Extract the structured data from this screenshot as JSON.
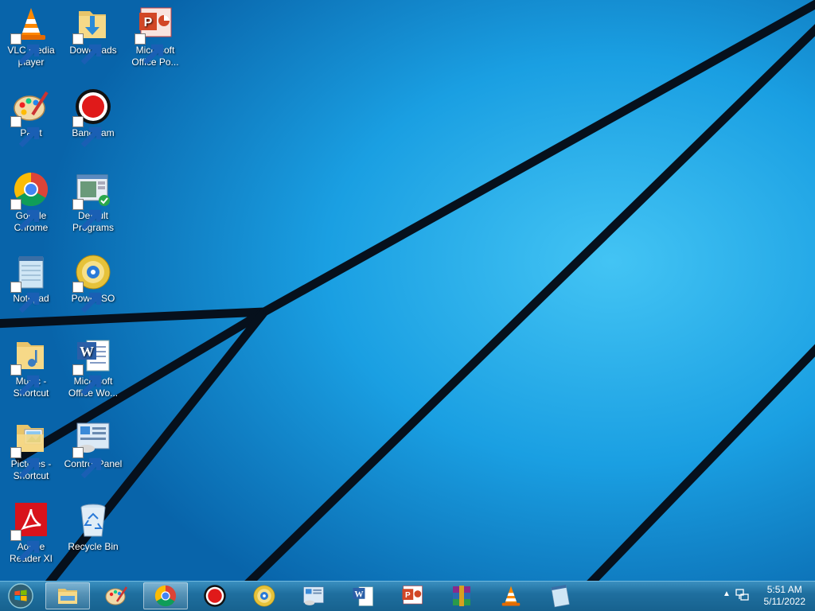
{
  "desktop": {
    "icons": [
      {
        "label": "VLC media player",
        "icon": "vlc-icon"
      },
      {
        "label": "Downloads",
        "icon": "downloads-folder-icon"
      },
      {
        "label": "Microsoft Office Po...",
        "icon": "powerpoint-icon"
      },
      {
        "label": "Paint",
        "icon": "paint-icon"
      },
      {
        "label": "Bandicam",
        "icon": "bandicam-icon"
      },
      {
        "label": "Google Chrome",
        "icon": "chrome-icon"
      },
      {
        "label": "Default Programs",
        "icon": "default-programs-icon"
      },
      {
        "label": "Notepad",
        "icon": "notepad-icon"
      },
      {
        "label": "PowerISO",
        "icon": "poweriso-icon"
      },
      {
        "label": "Music - Shortcut",
        "icon": "music-folder-icon"
      },
      {
        "label": "Microsoft Office Wo...",
        "icon": "word-icon"
      },
      {
        "label": "Pictures - Shortcut",
        "icon": "pictures-folder-icon"
      },
      {
        "label": "Control Panel",
        "icon": "control-panel-icon"
      },
      {
        "label": "Adobe Reader XI",
        "icon": "adobe-reader-icon"
      },
      {
        "label": "Recycle Bin",
        "icon": "recycle-bin-icon"
      }
    ]
  },
  "taskbar": {
    "start": "start-orb-icon",
    "pinned": [
      {
        "icon": "file-explorer-icon",
        "active": true
      },
      {
        "icon": "paint-icon",
        "active": false
      },
      {
        "icon": "chrome-icon",
        "active": true
      },
      {
        "icon": "bandicam-icon",
        "active": false
      },
      {
        "icon": "poweriso-icon",
        "active": false
      },
      {
        "icon": "control-panel-icon",
        "active": false
      },
      {
        "icon": "word-icon",
        "active": false
      },
      {
        "icon": "powerpoint-icon",
        "active": false
      },
      {
        "icon": "winrar-icon",
        "active": false
      },
      {
        "icon": "vlc-icon",
        "active": false
      },
      {
        "icon": "notepad-icon",
        "active": false
      }
    ],
    "tray": {
      "chevron": "▲",
      "time": "5:51 AM",
      "date": "5/11/2022"
    }
  }
}
